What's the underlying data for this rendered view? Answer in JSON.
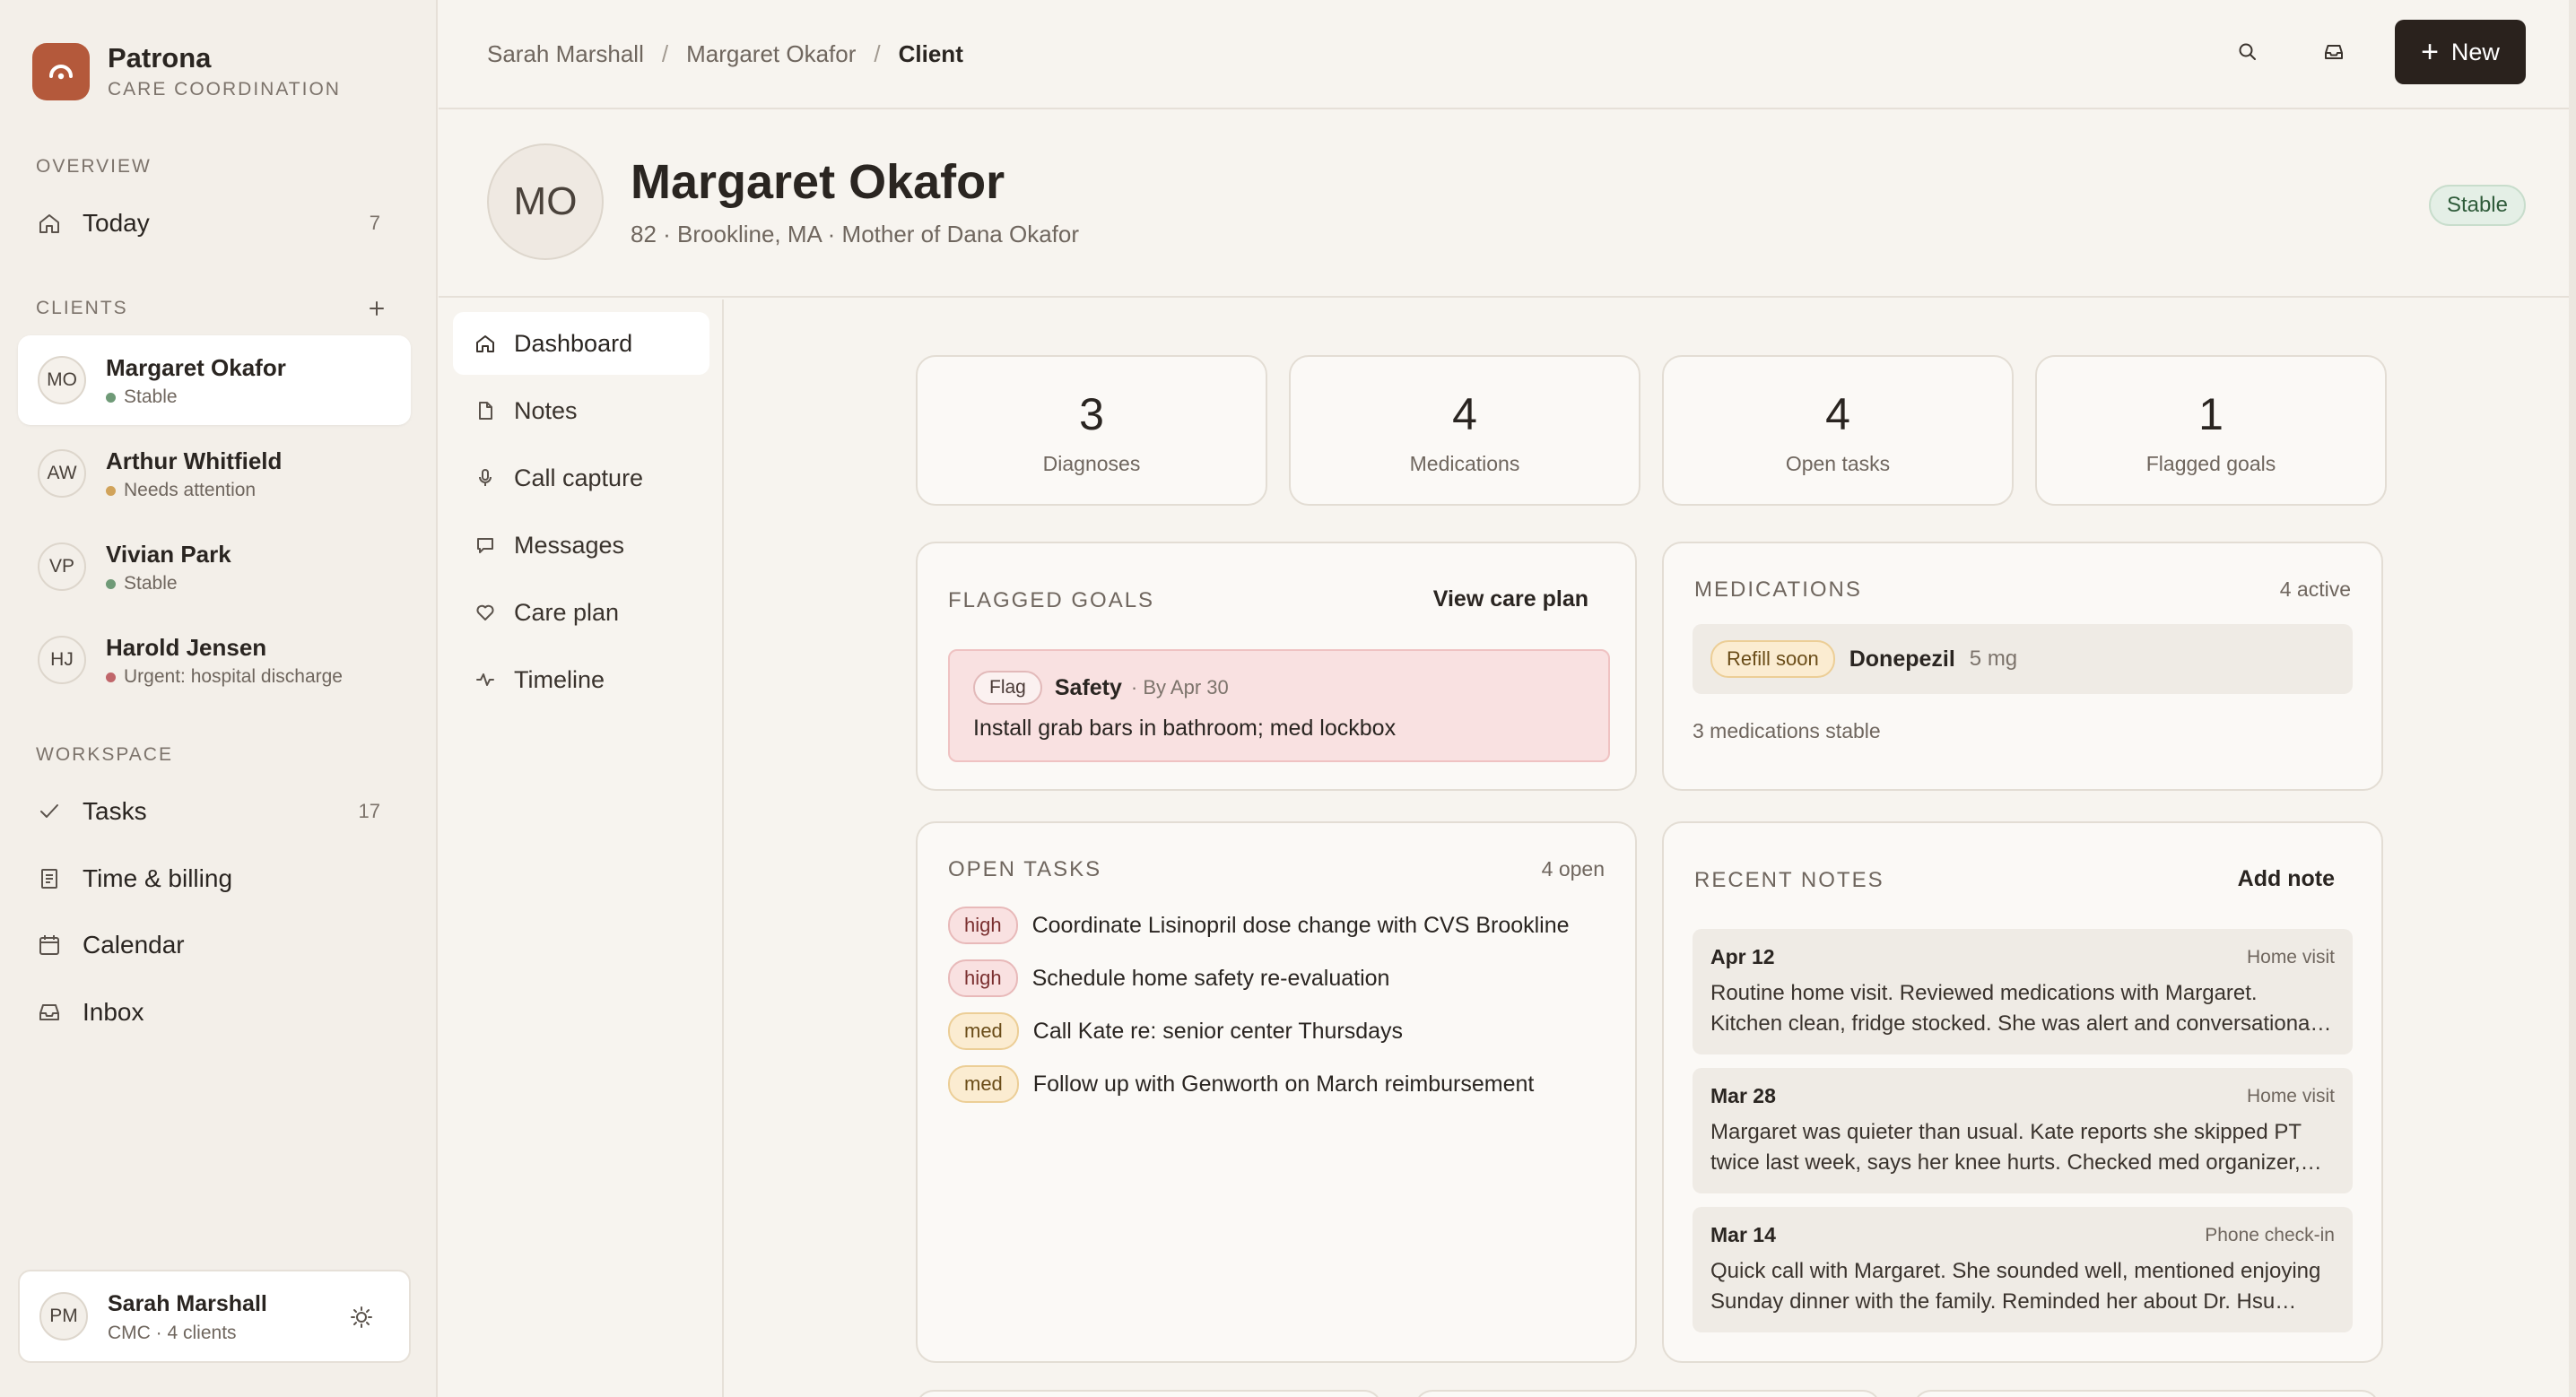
{
  "brand": {
    "name": "Patrona",
    "subtitle": "CARE COORDINATION",
    "color": "#b4593b"
  },
  "sidebar": {
    "overview_label": "OVERVIEW",
    "today": {
      "label": "Today",
      "count": "7"
    },
    "clients_label": "CLIENTS",
    "clients": [
      {
        "initials": "MO",
        "name": "Margaret Okafor",
        "status": "Stable",
        "status_color": "#6f9a77"
      },
      {
        "initials": "AW",
        "name": "Arthur Whitfield",
        "status": "Needs attention",
        "status_color": "#d1a35a"
      },
      {
        "initials": "VP",
        "name": "Vivian Park",
        "status": "Stable",
        "status_color": "#6f9a77"
      },
      {
        "initials": "HJ",
        "name": "Harold Jensen",
        "status": "Urgent: hospital discharge",
        "status_color": "#c0666a"
      }
    ],
    "workspace_label": "WORKSPACE",
    "workspace": [
      {
        "label": "Tasks",
        "count": "17",
        "icon": "check-icon"
      },
      {
        "label": "Time & billing",
        "count": "",
        "icon": "receipt-icon"
      },
      {
        "label": "Calendar",
        "count": "",
        "icon": "calendar-icon"
      },
      {
        "label": "Inbox",
        "count": "",
        "icon": "inbox-icon"
      }
    ],
    "user": {
      "initials": "PM",
      "name": "Sarah Marshall",
      "meta": "CMC · 4 clients"
    }
  },
  "breadcrumb": [
    "Sarah Marshall",
    "Margaret Okafor",
    "Client"
  ],
  "topbar": {
    "new_label": "New"
  },
  "client": {
    "initials": "MO",
    "name": "Margaret Okafor",
    "meta": "82 · Brookline, MA · Mother of Dana Okafor",
    "status": "Stable"
  },
  "subnav": [
    {
      "label": "Dashboard",
      "icon": "home-icon"
    },
    {
      "label": "Notes",
      "icon": "document-icon"
    },
    {
      "label": "Call capture",
      "icon": "microphone-icon"
    },
    {
      "label": "Messages",
      "icon": "message-icon"
    },
    {
      "label": "Care plan",
      "icon": "heart-icon"
    },
    {
      "label": "Timeline",
      "icon": "activity-icon"
    }
  ],
  "stats": [
    {
      "value": "3",
      "label": "Diagnoses"
    },
    {
      "value": "4",
      "label": "Medications"
    },
    {
      "value": "4",
      "label": "Open tasks"
    },
    {
      "value": "1",
      "label": "Flagged goals"
    }
  ],
  "flagged_goals": {
    "title": "FLAGGED GOALS",
    "link": "View care plan",
    "item": {
      "tag": "Flag",
      "category": "Safety",
      "due": "· By Apr 30",
      "text": "Install grab bars in bathroom; med lockbox"
    }
  },
  "medications": {
    "title": "MEDICATIONS",
    "count": "4 active",
    "item": {
      "badge": "Refill soon",
      "name": "Donepezil",
      "dose": "5 mg"
    },
    "footer": "3 medications stable"
  },
  "open_tasks": {
    "title": "OPEN TASKS",
    "count": "4 open",
    "items": [
      {
        "priority": "high",
        "text": "Coordinate Lisinopril dose change with CVS Brookline"
      },
      {
        "priority": "high",
        "text": "Schedule home safety re-evaluation"
      },
      {
        "priority": "med",
        "text": "Call Kate re: senior center Thursdays"
      },
      {
        "priority": "med",
        "text": "Follow up with Genworth on March reimbursement"
      }
    ]
  },
  "recent_notes": {
    "title": "RECENT NOTES",
    "link": "Add note",
    "items": [
      {
        "date": "Apr 12",
        "type": "Home visit",
        "body": "Routine home visit. Reviewed medications with Margaret. Kitchen clean, fridge stocked. She was alert and conversational, asked about her grandchildren."
      },
      {
        "date": "Mar 28",
        "type": "Home visit",
        "body": "Margaret was quieter than usual. Kate reports she skipped PT twice last week, says her knee hurts. Checked med organizer, two doses missed."
      },
      {
        "date": "Mar 14",
        "type": "Phone check-in",
        "body": "Quick call with Margaret. She sounded well, mentioned enjoying Sunday dinner with the family. Reminded her about Dr. Hsu appointment next week."
      }
    ]
  }
}
